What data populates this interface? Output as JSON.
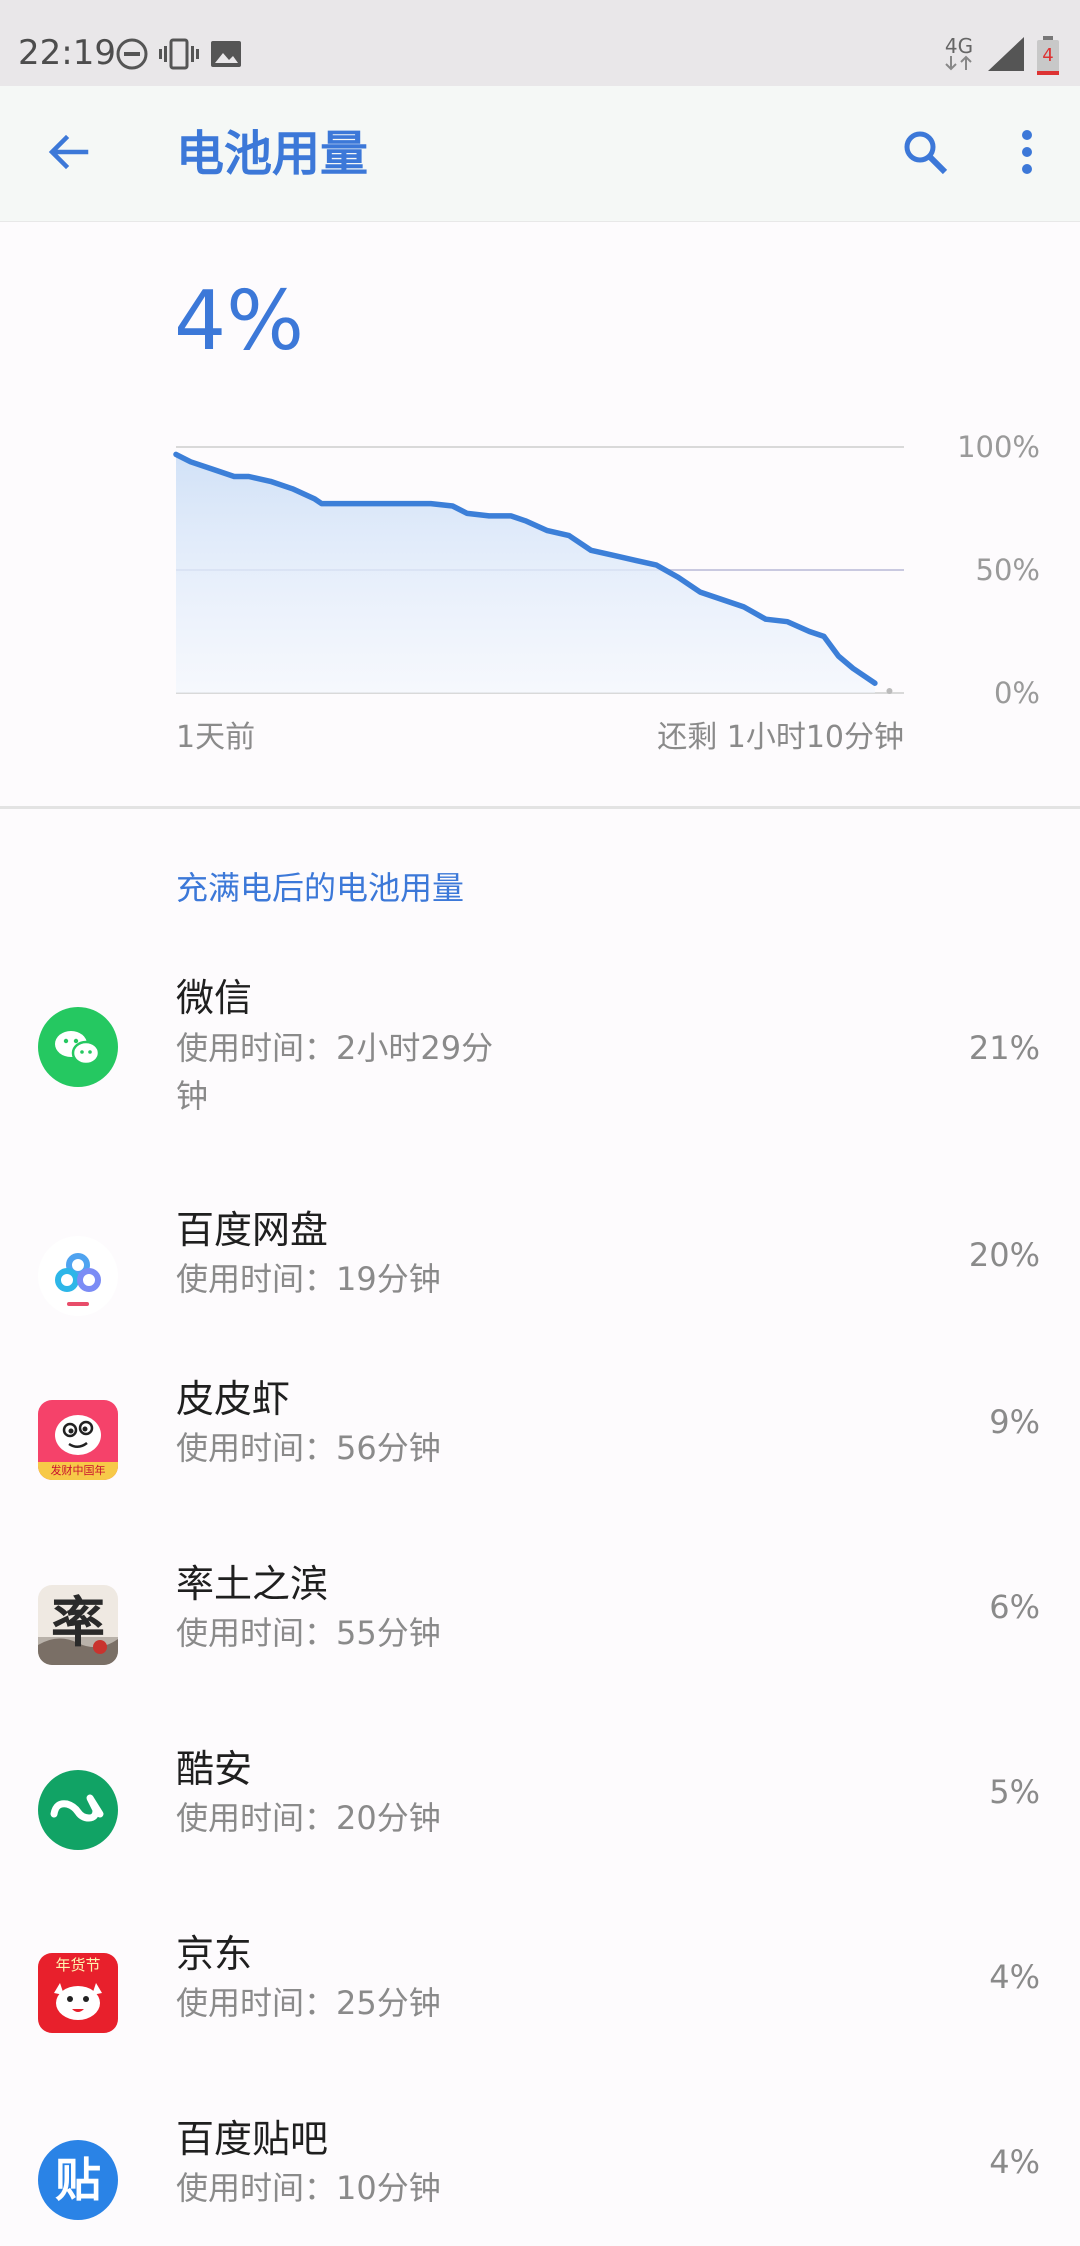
{
  "status_bar": {
    "time": "22:19",
    "network": "4G",
    "battery_level": "4",
    "icons": [
      "dnd-icon",
      "vibrate-icon",
      "image-icon",
      "network-arrows-icon",
      "signal-icon",
      "battery-icon"
    ]
  },
  "app_bar": {
    "title": "电池用量",
    "back_icon": "arrow-left-icon",
    "search_icon": "search-icon",
    "more_icon": "more-vert-icon"
  },
  "battery": {
    "percent": "4%"
  },
  "chart_data": {
    "type": "area",
    "title": "",
    "xlabel": "",
    "ylabel": "",
    "x": [
      0,
      0.02,
      0.05,
      0.08,
      0.1,
      0.13,
      0.16,
      0.19,
      0.2,
      0.23,
      0.26,
      0.29,
      0.32,
      0.35,
      0.38,
      0.4,
      0.43,
      0.46,
      0.48,
      0.51,
      0.54,
      0.57,
      0.6,
      0.63,
      0.66,
      0.69,
      0.72,
      0.75,
      0.78,
      0.81,
      0.84,
      0.87,
      0.89,
      0.91,
      0.93,
      0.96
    ],
    "series": [
      {
        "values": [
          97,
          94,
          91,
          88,
          88,
          86,
          83,
          79,
          77,
          77,
          77,
          77,
          77,
          77,
          76,
          73,
          72,
          72,
          70,
          66,
          64,
          58,
          56,
          54,
          52,
          47,
          41,
          38,
          35,
          30,
          29,
          25,
          23,
          15,
          10,
          4
        ]
      }
    ],
    "y_ticks": [
      "100%",
      "50%",
      "0%"
    ],
    "ylim": [
      0,
      100
    ],
    "x_labels": {
      "start": "1天前",
      "end": "还剩 1小时10分钟"
    },
    "grid": true,
    "line_color": "#3c7fd8",
    "fill_color": "#dbe8f8"
  },
  "section": {
    "title": "充满电后的电池用量"
  },
  "apps": [
    {
      "name": "微信",
      "usage_label": "使用时间：",
      "usage_value": "2小时29分钟",
      "percent": "21%",
      "icon": "wechat-icon"
    },
    {
      "name": "百度网盘",
      "usage_label": "使用时间：",
      "usage_value": "19分钟",
      "percent": "20%",
      "icon": "baidu-netdisk-icon"
    },
    {
      "name": "皮皮虾",
      "usage_label": "使用时间：",
      "usage_value": "56分钟",
      "percent": "9%",
      "icon": "pipixia-icon",
      "icon_caption": "发财中国年"
    },
    {
      "name": "率土之滨",
      "usage_label": "使用时间：",
      "usage_value": "55分钟",
      "percent": "6%",
      "icon": "shuaitu-icon",
      "icon_caption": "率"
    },
    {
      "name": "酷安",
      "usage_label": "使用时间：",
      "usage_value": "20分钟",
      "percent": "5%",
      "icon": "coolapk-icon"
    },
    {
      "name": "京东",
      "usage_label": "使用时间：",
      "usage_value": "25分钟",
      "percent": "4%",
      "icon": "jd-icon",
      "icon_caption": "年货节"
    },
    {
      "name": "百度贴吧",
      "usage_label": "使用时间：",
      "usage_value": "10分钟",
      "percent": "4%",
      "icon": "baidu-tieba-icon",
      "icon_caption": "贴"
    }
  ]
}
